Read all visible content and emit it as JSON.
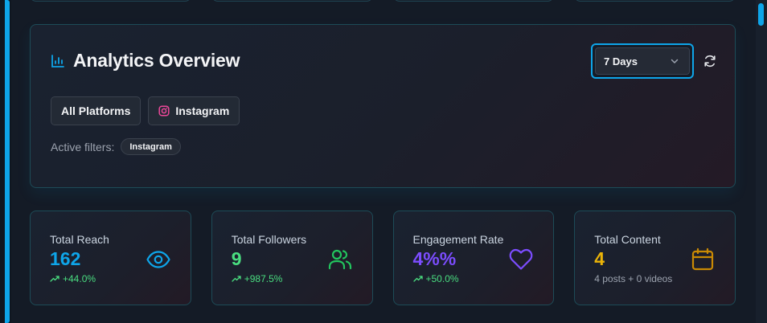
{
  "overview": {
    "title": "Analytics Overview",
    "range": "7 Days",
    "platform_chips": [
      "All Platforms",
      "Instagram"
    ],
    "active_filters_label": "Active filters:",
    "active_filter": "Instagram"
  },
  "stats": [
    {
      "label": "Total Reach",
      "value": "162",
      "sub": "+44.0%",
      "color": "#0ea5e9",
      "icon": "eye-icon"
    },
    {
      "label": "Total Followers",
      "value": "9",
      "sub": "+987.5%",
      "color": "#4ade80",
      "icon": "users-icon"
    },
    {
      "label": "Engagement Rate",
      "value": "4%%",
      "sub": "+50.0%",
      "color": "#7c4dff",
      "icon": "heart-icon"
    },
    {
      "label": "Total Content",
      "value": "4",
      "sub": "4 posts + 0 videos",
      "color": "#eab308",
      "icon": "calendar-icon"
    }
  ],
  "colors": {
    "accent": "#0ea5e9",
    "positive": "#4ade80",
    "instagram": "#ec4899"
  }
}
